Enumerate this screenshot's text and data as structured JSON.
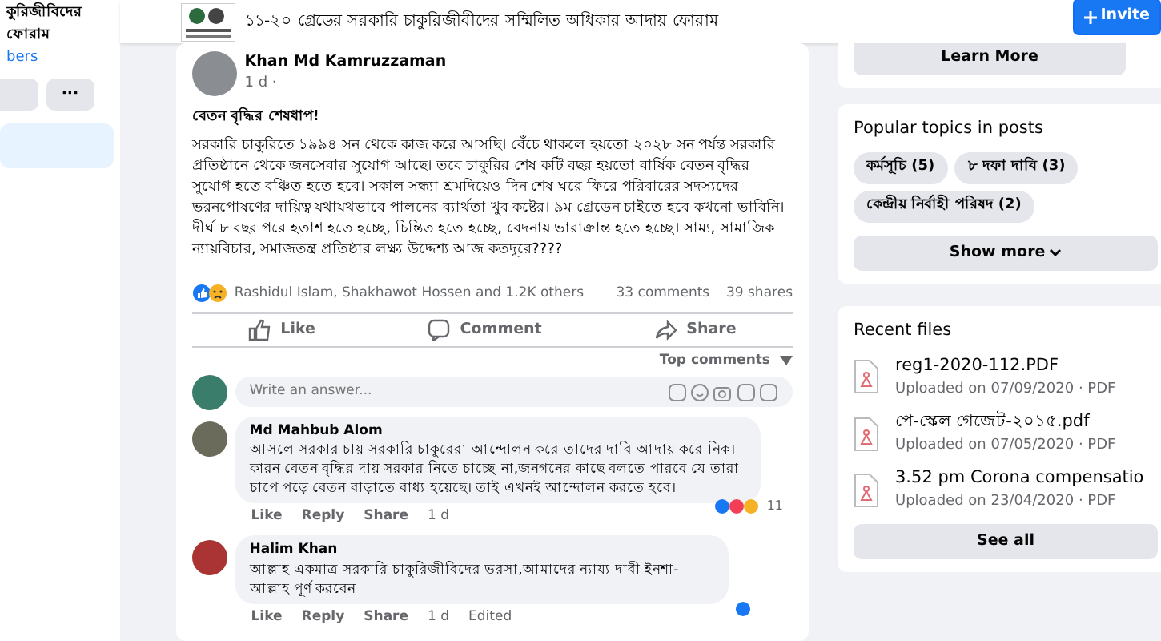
{
  "sidebar": {
    "group_name_lines": [
      "কুরিজীবিদের",
      "ফোরাম"
    ],
    "members_text": "bers",
    "more_button": "···"
  },
  "header": {
    "group_title": "১১-২০ গ্রেডের সরকারি চাকুরিজীবীদের সম্মিলিত অধিকার আদায় ফোরাম",
    "invite_button": "Invite"
  },
  "post": {
    "author": "Khan Md Kamruzzaman",
    "time": "1 d ·",
    "title": "বেতন বৃদ্ধির শেষধাপ!",
    "body": "সরকারি চাকুরিতে ১৯৯৪ সন থেকে কাজ করে আসছি। বেঁচে থাকলে হয়তো ২০২৮ সন পর্যন্ত সরকারি প্রতিষ্ঠানে থেকে জনসেবার সুযোগ আছে। তবে চাকুরির শেষ কটি বছর হয়তো বার্ষিক বেতন বৃদ্ধির সুযোগ হতে বঞ্চিত হতে হবে। সকাল সন্ধ্যা শ্রমদিয়েও দিন শেষ ঘরে ফিরে পরিবারের সদস্যদের ভরনপোষণের দায়িত্ব যথাযথভাবে পালনের ব্যার্থতা খুব কষ্টের। ৯ম গ্রেডেন চাইতে হবে কখনো ভাবিনি। দীর্ঘ ৮ বছর পরে হতাশ হতে হচ্ছে, চিন্তিত হতে হচ্ছে, বেদনায় ভারাক্রান্ত হতে হচ্ছে। সাম্য, সামাজিক ন্যায়বিচার, সমাজতন্ত্র প্রতিষ্ঠার লক্ষ্য উদ্দেশ্য আজ কতদূরে????",
    "reactions_text": "Rashidul Islam, Shakhawot Hossen and 1.2K others",
    "comments_count": "33 comments",
    "shares_count": "39 shares",
    "actions": [
      {
        "kind": "like",
        "label": "Like"
      },
      {
        "kind": "comment",
        "label": "Comment"
      },
      {
        "kind": "share",
        "label": "Share"
      }
    ],
    "sort_label": "Top comments",
    "answer_placeholder": "Write an answer...",
    "comments": [
      {
        "author": "Md Mahbub Alom",
        "text": "আসলে সরকার চায় সরকারি চাকুরেরা আন্দোলন করে তাদের দাবি আদায় করে নিক। কারন বেতন বৃদ্ধির দায় সরকার নিতে চাচ্ছে না,জনগনের কাছে বলতে পারবে যে তারা চাপে পড়ে বেতন বাড়াতে বাধ্য হয়েছে। তাই এখনই আন্দোলন করতে হবে।",
        "reaction_count": "11",
        "actions": [
          "Like",
          "Reply",
          "Share"
        ],
        "time": "1 d"
      },
      {
        "author": "Halim Khan",
        "text": "আল্লাহ একমাত্র সরকারি চাকুরিজীবিদের ভরসা,আমাদের ন্যায্য দাবী ইনশা-আল্লাহ পূর্ণ করবেন",
        "actions": [
          "Like",
          "Reply",
          "Share"
        ],
        "time": "1 d",
        "edited": "Edited"
      }
    ]
  },
  "right": {
    "learn_more_button": "Learn More",
    "topics": {
      "title": "Popular topics in posts",
      "items": [
        "কর্মসূচি (5)",
        "৮ দফা দাবি (3)",
        "কেন্দ্রীয় নির্বাহী পরিষদ (2)"
      ],
      "show_more": "Show more"
    },
    "files": {
      "title": "Recent files",
      "items": [
        {
          "name": "reg1-2020-112.PDF",
          "meta": "Uploaded on 07/09/2020 · PDF"
        },
        {
          "name": "পে-স্কেল গেজেট-২০১৫.pdf",
          "meta": "Uploaded on 07/05/2020 · PDF"
        },
        {
          "name": "3.52 pm Corona compensatio",
          "meta": "Uploaded on 23/04/2020 · PDF"
        }
      ],
      "see_all": "See all"
    }
  }
}
